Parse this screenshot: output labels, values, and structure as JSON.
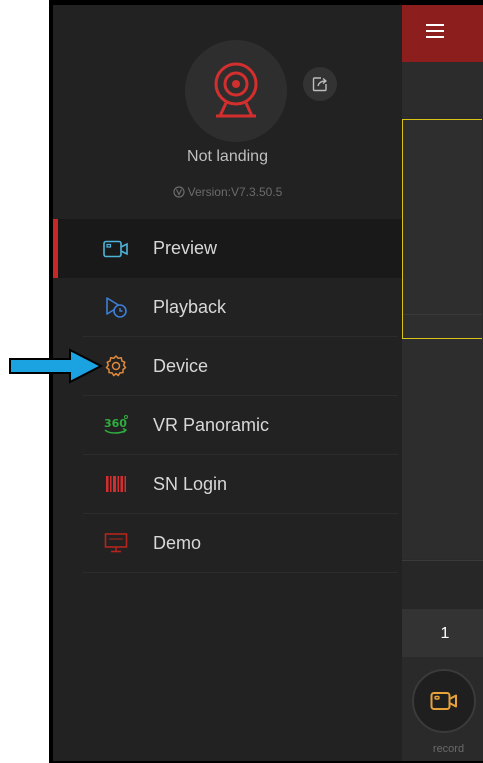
{
  "header": {
    "menu_icon": "hamburger-icon"
  },
  "profile": {
    "avatar_icon": "webcam-icon",
    "status": "Not landing",
    "version": "Version:V7.3.50.5",
    "share_icon": "share-icon"
  },
  "menu": {
    "items": [
      {
        "label": "Preview",
        "icon": "camera-icon",
        "active": true
      },
      {
        "label": "Playback",
        "icon": "playback-icon",
        "active": false
      },
      {
        "label": "Device",
        "icon": "gear-icon",
        "active": false
      },
      {
        "label": "VR Panoramic",
        "icon": "vr-360-icon",
        "active": false
      },
      {
        "label": "SN Login",
        "icon": "barcode-icon",
        "active": false
      },
      {
        "label": "Demo",
        "icon": "monitor-icon",
        "active": false
      }
    ]
  },
  "background": {
    "page_number": "1",
    "record_label": "record"
  },
  "colors": {
    "accent_red": "#c62828",
    "top_bar_red": "#8c1e1e",
    "selection_yellow": "#d8c417",
    "record_orange": "#e8a23a",
    "annotation_arrow": "#1aa3e0"
  }
}
